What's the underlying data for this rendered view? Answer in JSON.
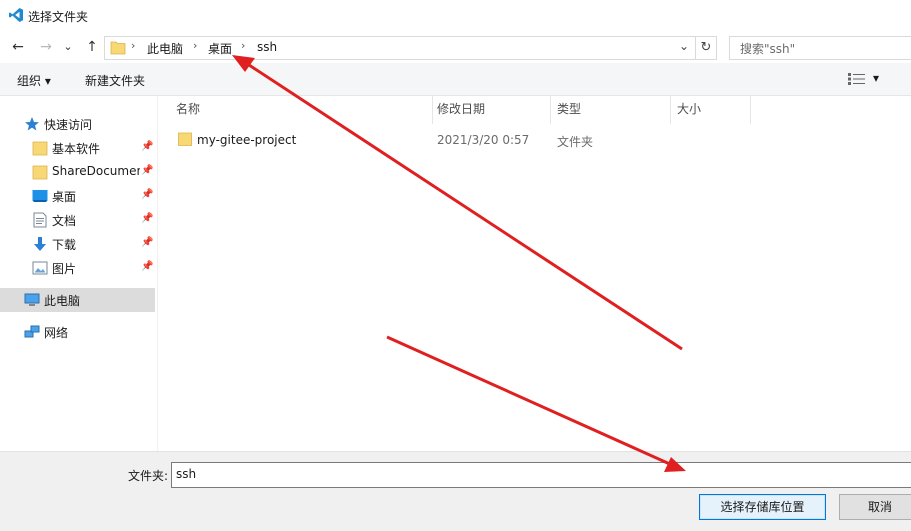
{
  "window": {
    "title": "选择文件夹"
  },
  "nav": {
    "back": "←",
    "forward": "→",
    "recent": "⌄",
    "up": "↑"
  },
  "address": {
    "segments": [
      "此电脑",
      "桌面",
      "ssh"
    ],
    "separator": "›",
    "dropdown": "⌄",
    "refresh": "↻"
  },
  "search": {
    "placeholder": "搜索\"ssh\""
  },
  "toolbar": {
    "organize": "组织 ▾",
    "new_folder": "新建文件夹",
    "view": "▾"
  },
  "sidebar": {
    "quick_access": "快速访问",
    "items": [
      {
        "label": "基本软件",
        "icon": "folder-icon",
        "pinned": true
      },
      {
        "label": "ShareDocumen",
        "icon": "folder-icon",
        "pinned": true
      },
      {
        "label": "桌面",
        "icon": "desktop-icon",
        "pinned": true
      },
      {
        "label": "文档",
        "icon": "document-icon",
        "pinned": true
      },
      {
        "label": "下载",
        "icon": "download-icon",
        "pinned": true
      },
      {
        "label": "图片",
        "icon": "picture-icon",
        "pinned": true
      }
    ],
    "this_pc": "此电脑",
    "network": "网络",
    "pin_glyph": "📌"
  },
  "columns": {
    "name": "名称",
    "modified": "修改日期",
    "type": "类型",
    "size": "大小"
  },
  "files": [
    {
      "name": "my-gitee-project",
      "modified": "2021/3/20 0:57",
      "type": "文件夹",
      "size": ""
    }
  ],
  "bottom": {
    "folder_label": "文件夹:",
    "folder_value": "ssh",
    "select_button": "选择存储库位置",
    "cancel_button": "取消"
  },
  "colors": {
    "accent": "#0078d7",
    "arrow": "#e02020",
    "folder": "#f8d775"
  }
}
